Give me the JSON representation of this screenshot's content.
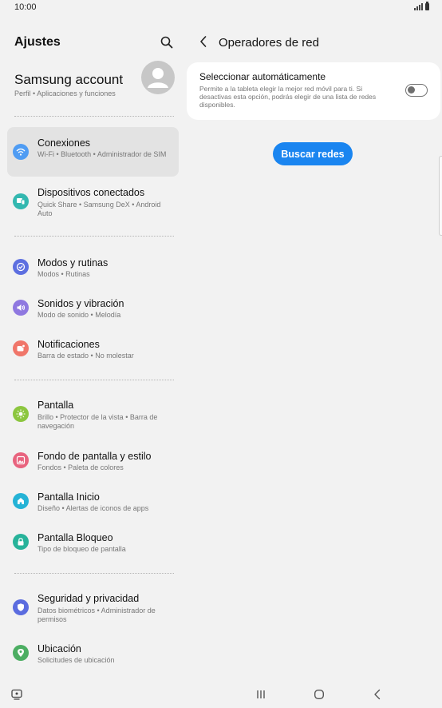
{
  "status_bar": {
    "time": "10:00"
  },
  "left_pane": {
    "title": "Ajustes",
    "account": {
      "title": "Samsung account",
      "subtitle": "Perfil  •  Aplicaciones y funciones"
    },
    "items": [
      {
        "title": "Conexiones",
        "subtitle": "Wi-Fi  •  Bluetooth  •  Administrador de SIM",
        "icon": "wifi-icon",
        "color": "#4f9cf3"
      },
      {
        "title": "Dispositivos conectados",
        "subtitle": "Quick Share  •  Samsung DeX  •  Android Auto",
        "icon": "devices-icon",
        "color": "#33b8b0"
      },
      {
        "title": "Modos y rutinas",
        "subtitle": "Modos  •  Rutinas",
        "icon": "check-circle-icon",
        "color": "#5d6fe0"
      },
      {
        "title": "Sonidos y vibración",
        "subtitle": "Modo de sonido  •  Melodía",
        "icon": "speaker-icon",
        "color": "#8f78e0"
      },
      {
        "title": "Notificaciones",
        "subtitle": "Barra de estado  •  No molestar",
        "icon": "notification-icon",
        "color": "#f0766a"
      },
      {
        "title": "Pantalla",
        "subtitle": "Brillo  •  Protector de la vista  •  Barra de navegación",
        "icon": "sun-icon",
        "color": "#8cc63f"
      },
      {
        "title": "Fondo de pantalla y estilo",
        "subtitle": "Fondos  •  Paleta de colores",
        "icon": "image-icon",
        "color": "#e8637e"
      },
      {
        "title": "Pantalla Inicio",
        "subtitle": "Diseño  •  Alertas de iconos de apps",
        "icon": "home-icon",
        "color": "#25b3d6"
      },
      {
        "title": "Pantalla Bloqueo",
        "subtitle": "Tipo de bloqueo de pantalla",
        "icon": "lock-icon",
        "color": "#27b39a"
      },
      {
        "title": "Seguridad y privacidad",
        "subtitle": "Datos biométricos  •  Administrador de permisos",
        "icon": "shield-icon",
        "color": "#5b6cdf"
      },
      {
        "title": "Ubicación",
        "subtitle": "Solicitudes de ubicación",
        "icon": "location-icon",
        "color": "#4cae62"
      }
    ]
  },
  "right_pane": {
    "title": "Operadores de red",
    "auto_select": {
      "title": "Seleccionar automáticamente",
      "description": "Permite a la tableta elegir la mejor red móvil para ti. Si desactivas esta opción, podrás elegir de una lista de redes disponibles.",
      "enabled": false
    },
    "search_button": "Buscar redes"
  },
  "colors": {
    "accent": "#1a85f0",
    "background": "#f2f2f2",
    "card": "#ffffff",
    "active_item": "#e3e3e3"
  }
}
